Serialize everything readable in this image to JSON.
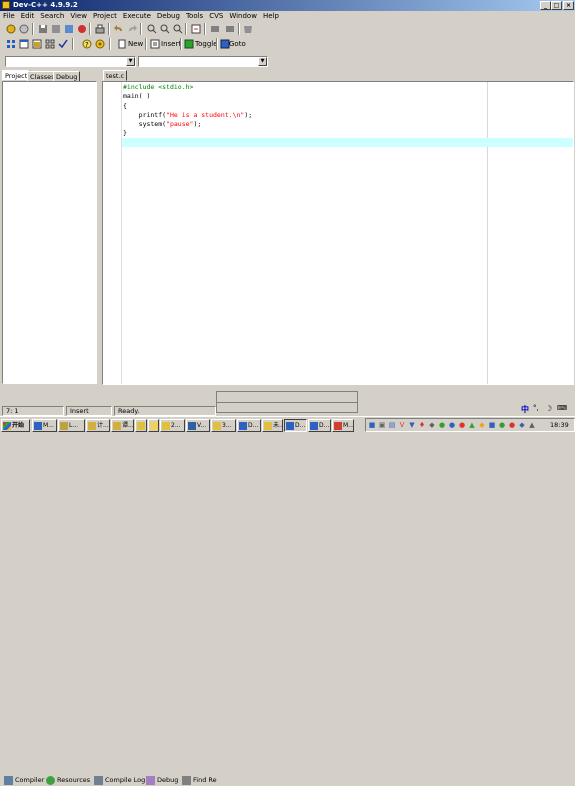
{
  "window": {
    "title": "Dev-C++ 4.9.9.2"
  },
  "menu": [
    "File",
    "Edit",
    "Search",
    "View",
    "Project",
    "Execute",
    "Debug",
    "Tools",
    "CVS",
    "Window",
    "Help"
  ],
  "toolbar": {
    "new_label": "New",
    "insert_label": "Insert",
    "toggle_label": "Toggle",
    "goto_label": "Goto"
  },
  "left_panel": {
    "tabs": [
      "Project",
      "Classes",
      "Debug"
    ]
  },
  "editor": {
    "file_tab": "test.c",
    "lines": [
      {
        "parts": [
          {
            "t": "#include <stdio.h>",
            "c": "kw"
          }
        ]
      },
      {
        "parts": [
          {
            "t": "main( )",
            "c": ""
          }
        ]
      },
      {
        "parts": [
          {
            "t": "{",
            "c": ""
          }
        ]
      },
      {
        "parts": [
          {
            "t": "    printf(",
            "c": ""
          },
          {
            "t": "\"He is a student.\\n\"",
            "c": "str"
          },
          {
            "t": ");",
            "c": ""
          }
        ]
      },
      {
        "parts": [
          {
            "t": "    system(",
            "c": ""
          },
          {
            "t": "\"pause\"",
            "c": "str"
          },
          {
            "t": ");",
            "c": ""
          }
        ]
      },
      {
        "parts": [
          {
            "t": "}",
            "c": ""
          }
        ]
      },
      {
        "parts": [
          {
            "t": "",
            "c": ""
          }
        ]
      }
    ]
  },
  "bottom_tabs": [
    "Compiler",
    "Resources",
    "Compile Log",
    "Debug",
    "Find Re"
  ],
  "status": {
    "position": "7: 1",
    "mode": "Insert",
    "message": "Ready."
  },
  "taskbar": {
    "start": "开始",
    "items": [
      "M...",
      "L...",
      "计...",
      "谭...",
      "",
      "",
      "2...",
      "V...",
      "3...",
      "D...",
      "未...",
      "D...",
      "D...",
      "M..."
    ],
    "clock": "18:39"
  },
  "ime": {
    "label": "中"
  }
}
